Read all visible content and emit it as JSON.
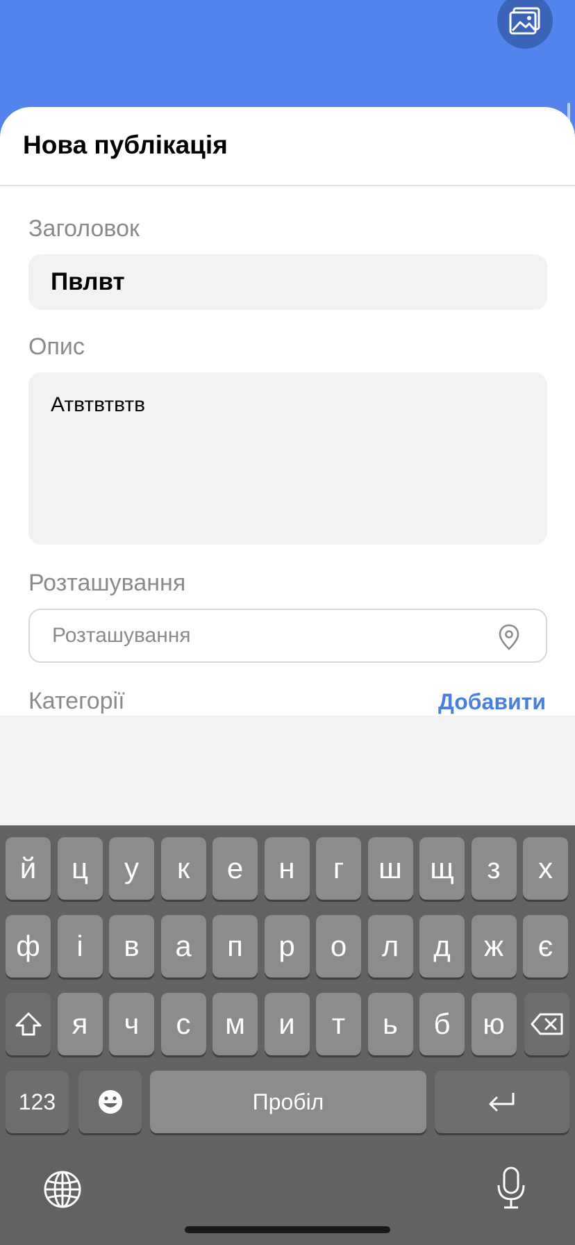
{
  "header": {
    "sheet_title": "Нова публікація"
  },
  "form": {
    "title_label": "Заголовок",
    "title_value": "Пвлвт",
    "description_label": "Опис",
    "description_value": "Атвтвтвтв",
    "location_label": "Розташування",
    "location_placeholder": "Розташування",
    "categories_label": "Категорії",
    "add_label": "Добавити"
  },
  "keyboard": {
    "row1": [
      "й",
      "ц",
      "у",
      "к",
      "е",
      "н",
      "г",
      "ш",
      "щ",
      "з",
      "х"
    ],
    "row2": [
      "ф",
      "і",
      "в",
      "а",
      "п",
      "р",
      "о",
      "л",
      "д",
      "ж",
      "є"
    ],
    "row3": [
      "я",
      "ч",
      "с",
      "м",
      "и",
      "т",
      "ь",
      "б",
      "ю"
    ],
    "numbers_key": "123",
    "space_key": "Пробіл"
  },
  "colors": {
    "accent": "#5384eb",
    "link": "#4a7fe0"
  }
}
